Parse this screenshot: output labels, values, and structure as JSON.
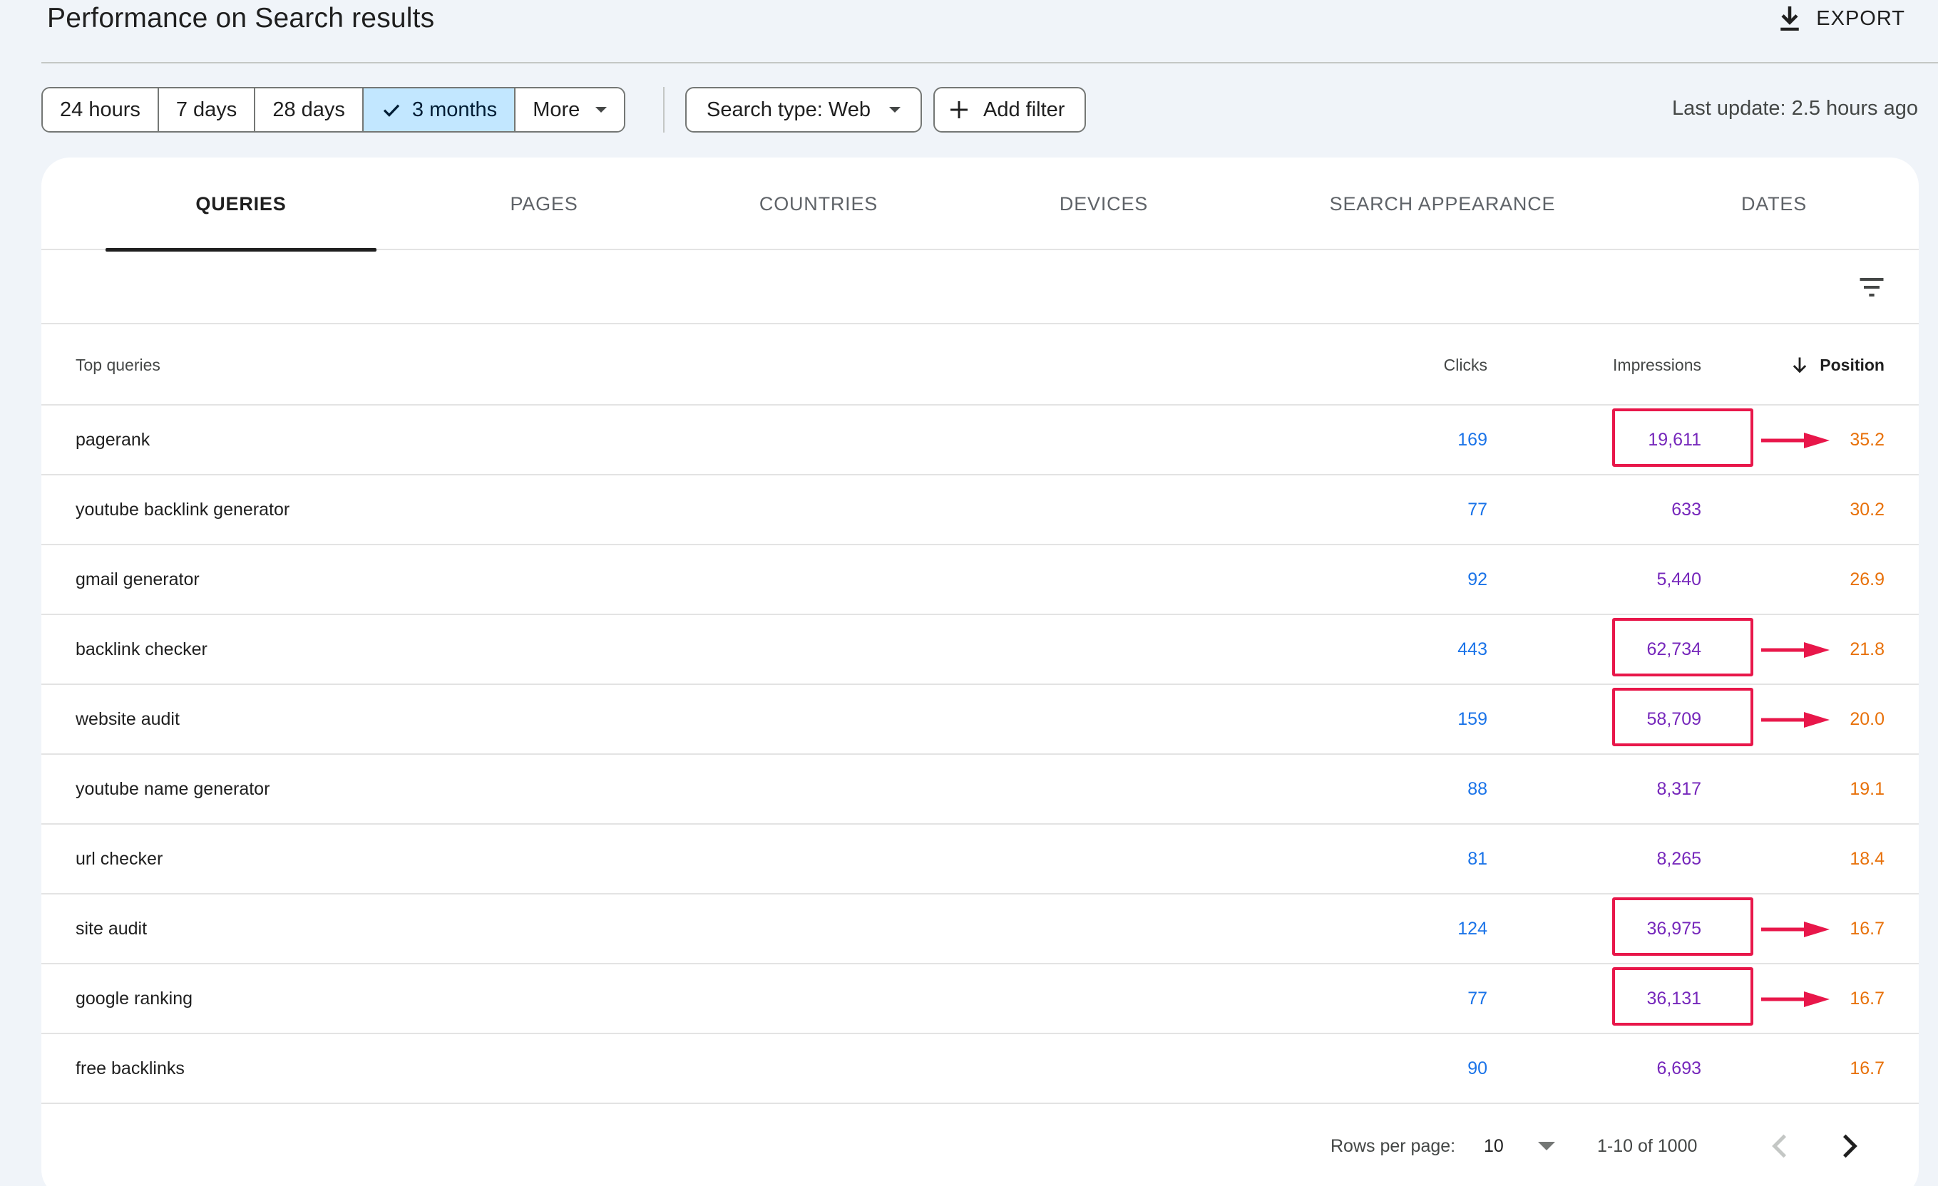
{
  "header": {
    "title": "Performance on Search results",
    "export_label": "EXPORT"
  },
  "toolbar": {
    "date_ranges": [
      "24 hours",
      "7 days",
      "28 days",
      "3 months",
      "More"
    ],
    "selected_range": "3 months",
    "search_type_label": "Search type: Web",
    "add_filter_label": "Add filter",
    "last_update": "Last update: 2.5 hours ago"
  },
  "tabs": [
    "QUERIES",
    "PAGES",
    "COUNTRIES",
    "DEVICES",
    "SEARCH APPEARANCE",
    "DATES"
  ],
  "active_tab": "QUERIES",
  "table": {
    "columns": {
      "query": "Top queries",
      "clicks": "Clicks",
      "impressions": "Impressions",
      "position": "Position"
    },
    "sorted_by": "Position",
    "rows": [
      {
        "query": "pagerank",
        "clicks": "169",
        "impressions": "19,611",
        "position": "35.2",
        "highlighted": true
      },
      {
        "query": "youtube backlink generator",
        "clicks": "77",
        "impressions": "633",
        "position": "30.2",
        "highlighted": false
      },
      {
        "query": "gmail generator",
        "clicks": "92",
        "impressions": "5,440",
        "position": "26.9",
        "highlighted": false
      },
      {
        "query": "backlink checker",
        "clicks": "443",
        "impressions": "62,734",
        "position": "21.8",
        "highlighted": true
      },
      {
        "query": "website audit",
        "clicks": "159",
        "impressions": "58,709",
        "position": "20.0",
        "highlighted": true
      },
      {
        "query": "youtube name generator",
        "clicks": "88",
        "impressions": "8,317",
        "position": "19.1",
        "highlighted": false
      },
      {
        "query": "url checker",
        "clicks": "81",
        "impressions": "8,265",
        "position": "18.4",
        "highlighted": false
      },
      {
        "query": "site audit",
        "clicks": "124",
        "impressions": "36,975",
        "position": "16.7",
        "highlighted": true
      },
      {
        "query": "google ranking",
        "clicks": "77",
        "impressions": "36,131",
        "position": "16.7",
        "highlighted": true
      },
      {
        "query": "free backlinks",
        "clicks": "90",
        "impressions": "6,693",
        "position": "16.7",
        "highlighted": false
      }
    ]
  },
  "pagination": {
    "rows_per_page_label": "Rows per page:",
    "rows_per_page_value": "10",
    "range_label": "1-10 of 1000"
  },
  "colors": {
    "clicks": "#1a73e8",
    "impressions": "#7627bb",
    "position": "#e8710a",
    "annotation": "#e8174a",
    "selected_chip": "#c2e7ff"
  },
  "icons": {
    "export": "download-icon",
    "selected": "check-icon",
    "dropdown": "caret-down-icon",
    "add": "plus-icon",
    "filter": "filter-lines-icon",
    "sort": "arrow-down-icon",
    "prev": "chevron-left-icon",
    "next": "chevron-right-icon"
  }
}
